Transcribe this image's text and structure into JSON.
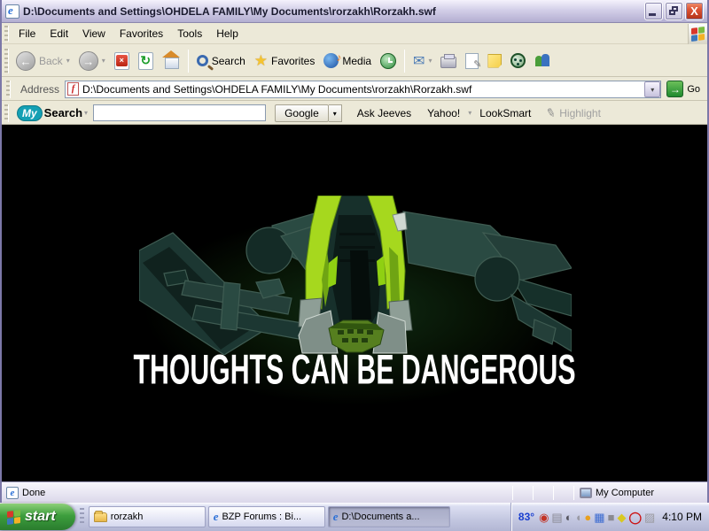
{
  "window": {
    "title": "D:\\Documents and Settings\\OHDELA FAMILY\\My Documents\\rorzakh\\Rorzakh.swf"
  },
  "menu": {
    "items": [
      "File",
      "Edit",
      "View",
      "Favorites",
      "Tools",
      "Help"
    ]
  },
  "toolbar": {
    "back_label": "Back",
    "search_label": "Search",
    "favorites_label": "Favorites",
    "media_label": "Media"
  },
  "address_bar": {
    "label": "Address",
    "value": "D:\\Documents and Settings\\OHDELA FAMILY\\My Documents\\rorzakh\\Rorzakh.swf",
    "go_label": "Go"
  },
  "search_toolbar": {
    "brand_my": "My",
    "brand_search": "Search",
    "input_value": "",
    "buttons": [
      "Google",
      "Ask Jeeves",
      "Yahoo!",
      "LookSmart"
    ],
    "highlight_label": "Highlight"
  },
  "content": {
    "caption": "THOUGHTS CAN BE DANGEROUS"
  },
  "status_bar": {
    "status": "Done",
    "zone": "My Computer"
  },
  "taskbar": {
    "start_label": "start",
    "tasks": [
      {
        "label": "rorzakh",
        "icon": "folder",
        "active": false
      },
      {
        "label": "BZP Forums : Bi...",
        "icon": "ie",
        "active": false
      },
      {
        "label": "D:\\Documents a...",
        "icon": "ie",
        "active": true
      }
    ],
    "tray": {
      "temperature": "83°",
      "clock": "4:10 PM",
      "icons": [
        {
          "name": "weatherbug-icon",
          "glyph": "◉"
        },
        {
          "name": "printer-status-icon",
          "glyph": "▤"
        },
        {
          "name": "volume-icon",
          "glyph": "◐"
        },
        {
          "name": "pointer-device-icon",
          "glyph": "◖"
        },
        {
          "name": "buddy-icon",
          "glyph": "●"
        },
        {
          "name": "display-settings-icon",
          "glyph": "▦"
        },
        {
          "name": "monitor-icon",
          "glyph": "■"
        },
        {
          "name": "diamond-utility-icon",
          "glyph": "◆"
        },
        {
          "name": "ring-icon",
          "glyph": "◯"
        },
        {
          "name": "pattern-icon",
          "glyph": "▨"
        }
      ]
    }
  },
  "icons": {
    "chevron": "▾",
    "arrow_left": "←",
    "arrow_right": "→",
    "stop_x": "×",
    "refresh": "↻",
    "music_note": "♪",
    "envelope": "✉",
    "pencil": "✎",
    "go_arrow": "→"
  },
  "colors": {
    "titlebar_lavender": "#c9c5e0",
    "toolbar_cream": "#ece9d8",
    "close_red": "#dd5436",
    "start_green": "#3d9e3d",
    "go_green": "#1f8a2e",
    "rahkshi_bright_green": "#a6d81e",
    "rahkshi_teal": "#1c3732",
    "caption_white": "#ffffff",
    "temp_blue": "#1a3fd0"
  }
}
